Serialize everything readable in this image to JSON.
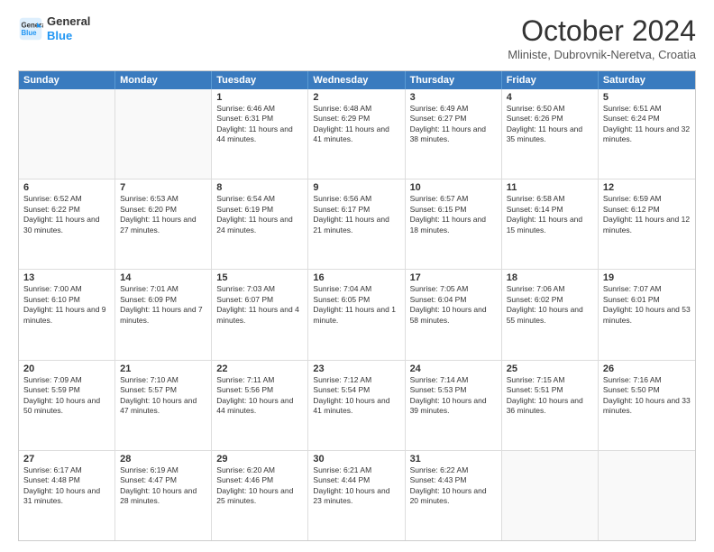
{
  "header": {
    "logo_line1": "General",
    "logo_line2": "Blue",
    "month_title": "October 2024",
    "location": "Mliniste, Dubrovnik-Neretva, Croatia"
  },
  "weekdays": [
    "Sunday",
    "Monday",
    "Tuesday",
    "Wednesday",
    "Thursday",
    "Friday",
    "Saturday"
  ],
  "rows": [
    [
      {
        "day": "",
        "text": "",
        "empty": true
      },
      {
        "day": "",
        "text": "",
        "empty": true
      },
      {
        "day": "1",
        "text": "Sunrise: 6:46 AM\nSunset: 6:31 PM\nDaylight: 11 hours and 44 minutes."
      },
      {
        "day": "2",
        "text": "Sunrise: 6:48 AM\nSunset: 6:29 PM\nDaylight: 11 hours and 41 minutes."
      },
      {
        "day": "3",
        "text": "Sunrise: 6:49 AM\nSunset: 6:27 PM\nDaylight: 11 hours and 38 minutes."
      },
      {
        "day": "4",
        "text": "Sunrise: 6:50 AM\nSunset: 6:26 PM\nDaylight: 11 hours and 35 minutes."
      },
      {
        "day": "5",
        "text": "Sunrise: 6:51 AM\nSunset: 6:24 PM\nDaylight: 11 hours and 32 minutes."
      }
    ],
    [
      {
        "day": "6",
        "text": "Sunrise: 6:52 AM\nSunset: 6:22 PM\nDaylight: 11 hours and 30 minutes."
      },
      {
        "day": "7",
        "text": "Sunrise: 6:53 AM\nSunset: 6:20 PM\nDaylight: 11 hours and 27 minutes."
      },
      {
        "day": "8",
        "text": "Sunrise: 6:54 AM\nSunset: 6:19 PM\nDaylight: 11 hours and 24 minutes."
      },
      {
        "day": "9",
        "text": "Sunrise: 6:56 AM\nSunset: 6:17 PM\nDaylight: 11 hours and 21 minutes."
      },
      {
        "day": "10",
        "text": "Sunrise: 6:57 AM\nSunset: 6:15 PM\nDaylight: 11 hours and 18 minutes."
      },
      {
        "day": "11",
        "text": "Sunrise: 6:58 AM\nSunset: 6:14 PM\nDaylight: 11 hours and 15 minutes."
      },
      {
        "day": "12",
        "text": "Sunrise: 6:59 AM\nSunset: 6:12 PM\nDaylight: 11 hours and 12 minutes."
      }
    ],
    [
      {
        "day": "13",
        "text": "Sunrise: 7:00 AM\nSunset: 6:10 PM\nDaylight: 11 hours and 9 minutes."
      },
      {
        "day": "14",
        "text": "Sunrise: 7:01 AM\nSunset: 6:09 PM\nDaylight: 11 hours and 7 minutes."
      },
      {
        "day": "15",
        "text": "Sunrise: 7:03 AM\nSunset: 6:07 PM\nDaylight: 11 hours and 4 minutes."
      },
      {
        "day": "16",
        "text": "Sunrise: 7:04 AM\nSunset: 6:05 PM\nDaylight: 11 hours and 1 minute."
      },
      {
        "day": "17",
        "text": "Sunrise: 7:05 AM\nSunset: 6:04 PM\nDaylight: 10 hours and 58 minutes."
      },
      {
        "day": "18",
        "text": "Sunrise: 7:06 AM\nSunset: 6:02 PM\nDaylight: 10 hours and 55 minutes."
      },
      {
        "day": "19",
        "text": "Sunrise: 7:07 AM\nSunset: 6:01 PM\nDaylight: 10 hours and 53 minutes."
      }
    ],
    [
      {
        "day": "20",
        "text": "Sunrise: 7:09 AM\nSunset: 5:59 PM\nDaylight: 10 hours and 50 minutes."
      },
      {
        "day": "21",
        "text": "Sunrise: 7:10 AM\nSunset: 5:57 PM\nDaylight: 10 hours and 47 minutes."
      },
      {
        "day": "22",
        "text": "Sunrise: 7:11 AM\nSunset: 5:56 PM\nDaylight: 10 hours and 44 minutes."
      },
      {
        "day": "23",
        "text": "Sunrise: 7:12 AM\nSunset: 5:54 PM\nDaylight: 10 hours and 41 minutes."
      },
      {
        "day": "24",
        "text": "Sunrise: 7:14 AM\nSunset: 5:53 PM\nDaylight: 10 hours and 39 minutes."
      },
      {
        "day": "25",
        "text": "Sunrise: 7:15 AM\nSunset: 5:51 PM\nDaylight: 10 hours and 36 minutes."
      },
      {
        "day": "26",
        "text": "Sunrise: 7:16 AM\nSunset: 5:50 PM\nDaylight: 10 hours and 33 minutes."
      }
    ],
    [
      {
        "day": "27",
        "text": "Sunrise: 6:17 AM\nSunset: 4:48 PM\nDaylight: 10 hours and 31 minutes."
      },
      {
        "day": "28",
        "text": "Sunrise: 6:19 AM\nSunset: 4:47 PM\nDaylight: 10 hours and 28 minutes."
      },
      {
        "day": "29",
        "text": "Sunrise: 6:20 AM\nSunset: 4:46 PM\nDaylight: 10 hours and 25 minutes."
      },
      {
        "day": "30",
        "text": "Sunrise: 6:21 AM\nSunset: 4:44 PM\nDaylight: 10 hours and 23 minutes."
      },
      {
        "day": "31",
        "text": "Sunrise: 6:22 AM\nSunset: 4:43 PM\nDaylight: 10 hours and 20 minutes."
      },
      {
        "day": "",
        "text": "",
        "empty": true
      },
      {
        "day": "",
        "text": "",
        "empty": true
      }
    ]
  ]
}
